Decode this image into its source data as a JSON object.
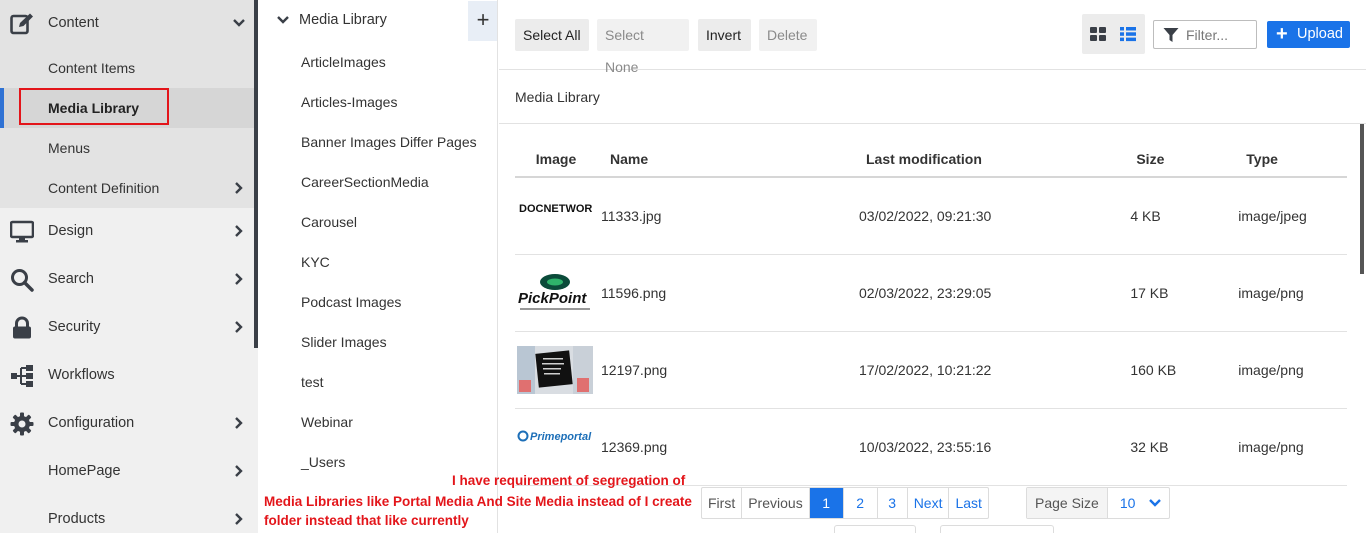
{
  "sidebar": {
    "items": [
      {
        "label": "Content",
        "icon": "edit-icon",
        "expanded": true
      },
      {
        "label": "Content Items"
      },
      {
        "label": "Media Library",
        "active": true
      },
      {
        "label": "Menus"
      },
      {
        "label": "Content Definition"
      },
      {
        "label": "Design",
        "icon": "monitor-icon"
      },
      {
        "label": "Search",
        "icon": "search-icon"
      },
      {
        "label": "Security",
        "icon": "lock-icon"
      },
      {
        "label": "Workflows",
        "icon": "sitemap-icon"
      },
      {
        "label": "Configuration",
        "icon": "gear-icon"
      },
      {
        "label": "HomePage"
      },
      {
        "label": "Products"
      }
    ]
  },
  "tree": {
    "root_label": "Media Library",
    "add_label": "+",
    "folders": [
      "ArticleImages",
      "Articles-Images",
      "Banner Images Differ Pages",
      "CareerSectionMedia",
      "Carousel",
      "KYC",
      "Podcast Images",
      "Slider Images",
      "test",
      "Webinar",
      "_Users"
    ]
  },
  "toolbar": {
    "select_all": "Select All",
    "select_none": "Select None",
    "invert": "Invert",
    "delete": "Delete",
    "filter_placeholder": "Filter...",
    "upload_label": "Upload"
  },
  "breadcrumb": "Media Library",
  "table": {
    "columns": [
      "Image",
      "Name",
      "Last modification",
      "Size",
      "Type"
    ],
    "rows": [
      {
        "thumb_text": "DOCNETWORK",
        "name": "11333.jpg",
        "modified": "03/02/2022, 09:21:30",
        "size": "4 KB",
        "type": "image/jpeg"
      },
      {
        "thumb_text": "PickPoint",
        "name": "11596.png",
        "modified": "02/03/2022, 23:29:05",
        "size": "17 KB",
        "type": "image/png"
      },
      {
        "thumb_text": "",
        "name": "12197.png",
        "modified": "17/02/2022, 10:21:22",
        "size": "160 KB",
        "type": "image/png"
      },
      {
        "thumb_text": "Primeportal",
        "name": "12369.png",
        "modified": "10/03/2022, 23:55:16",
        "size": "32 KB",
        "type": "image/png"
      }
    ]
  },
  "pager": {
    "first": "First",
    "previous": "Previous",
    "pages": [
      "1",
      "2",
      "3"
    ],
    "current": "1",
    "next": "Next",
    "last": "Last",
    "page_size_label": "Page Size",
    "page_size_value": "10"
  },
  "annotation": {
    "line1": "I have requirement of segregation of",
    "line2": "Media Libraries like Portal Media And Site Media instead of I create folder instead that like currently"
  },
  "colors": {
    "accent": "#1a73e8",
    "highlight_box": "#e3151a",
    "annotation_text": "#e3151a"
  }
}
